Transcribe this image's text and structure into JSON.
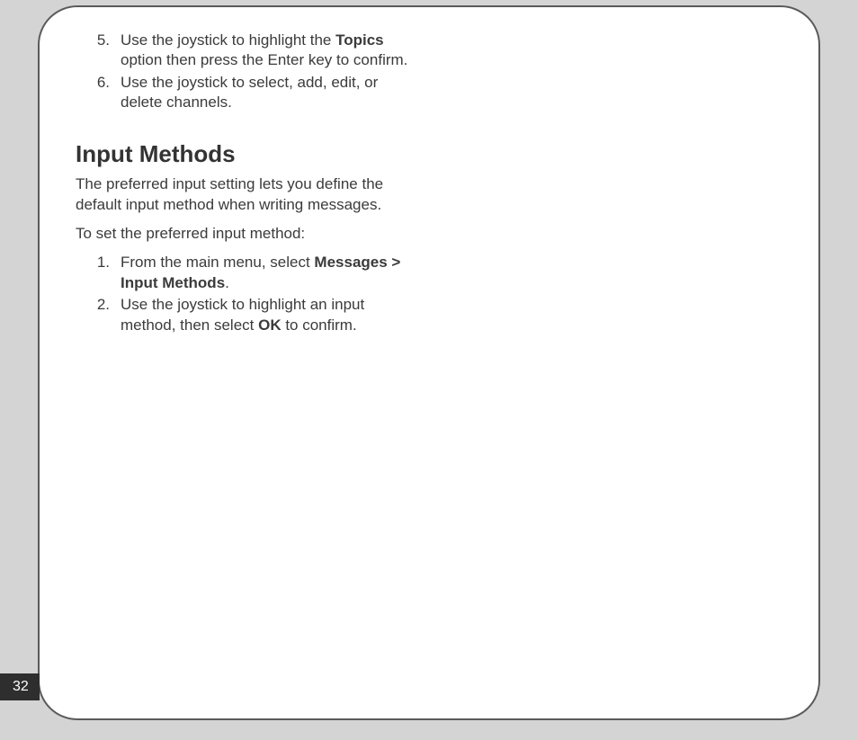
{
  "page_number": "32",
  "continued_list": {
    "items": [
      {
        "num": "5.",
        "pre": "Use the joystick to highlight the ",
        "bold": "Topics",
        "post": " option then press the Enter key  to confirm."
      },
      {
        "num": "6.",
        "pre": "Use the joystick to select, add, edit, or delete channels.",
        "bold": "",
        "post": ""
      }
    ]
  },
  "section": {
    "heading": "Input Methods",
    "para1": "The preferred input setting lets you define the default input method when writing  messages.",
    "para2": "To set the preferred input method:",
    "items": [
      {
        "num": "1.",
        "pre": "From the main menu, select ",
        "bold": "Messages > Input Methods",
        "post": "."
      },
      {
        "num": "2.",
        "pre": "Use the joystick to highlight an input method, then select ",
        "bold": "OK",
        "post": " to confirm."
      }
    ]
  }
}
